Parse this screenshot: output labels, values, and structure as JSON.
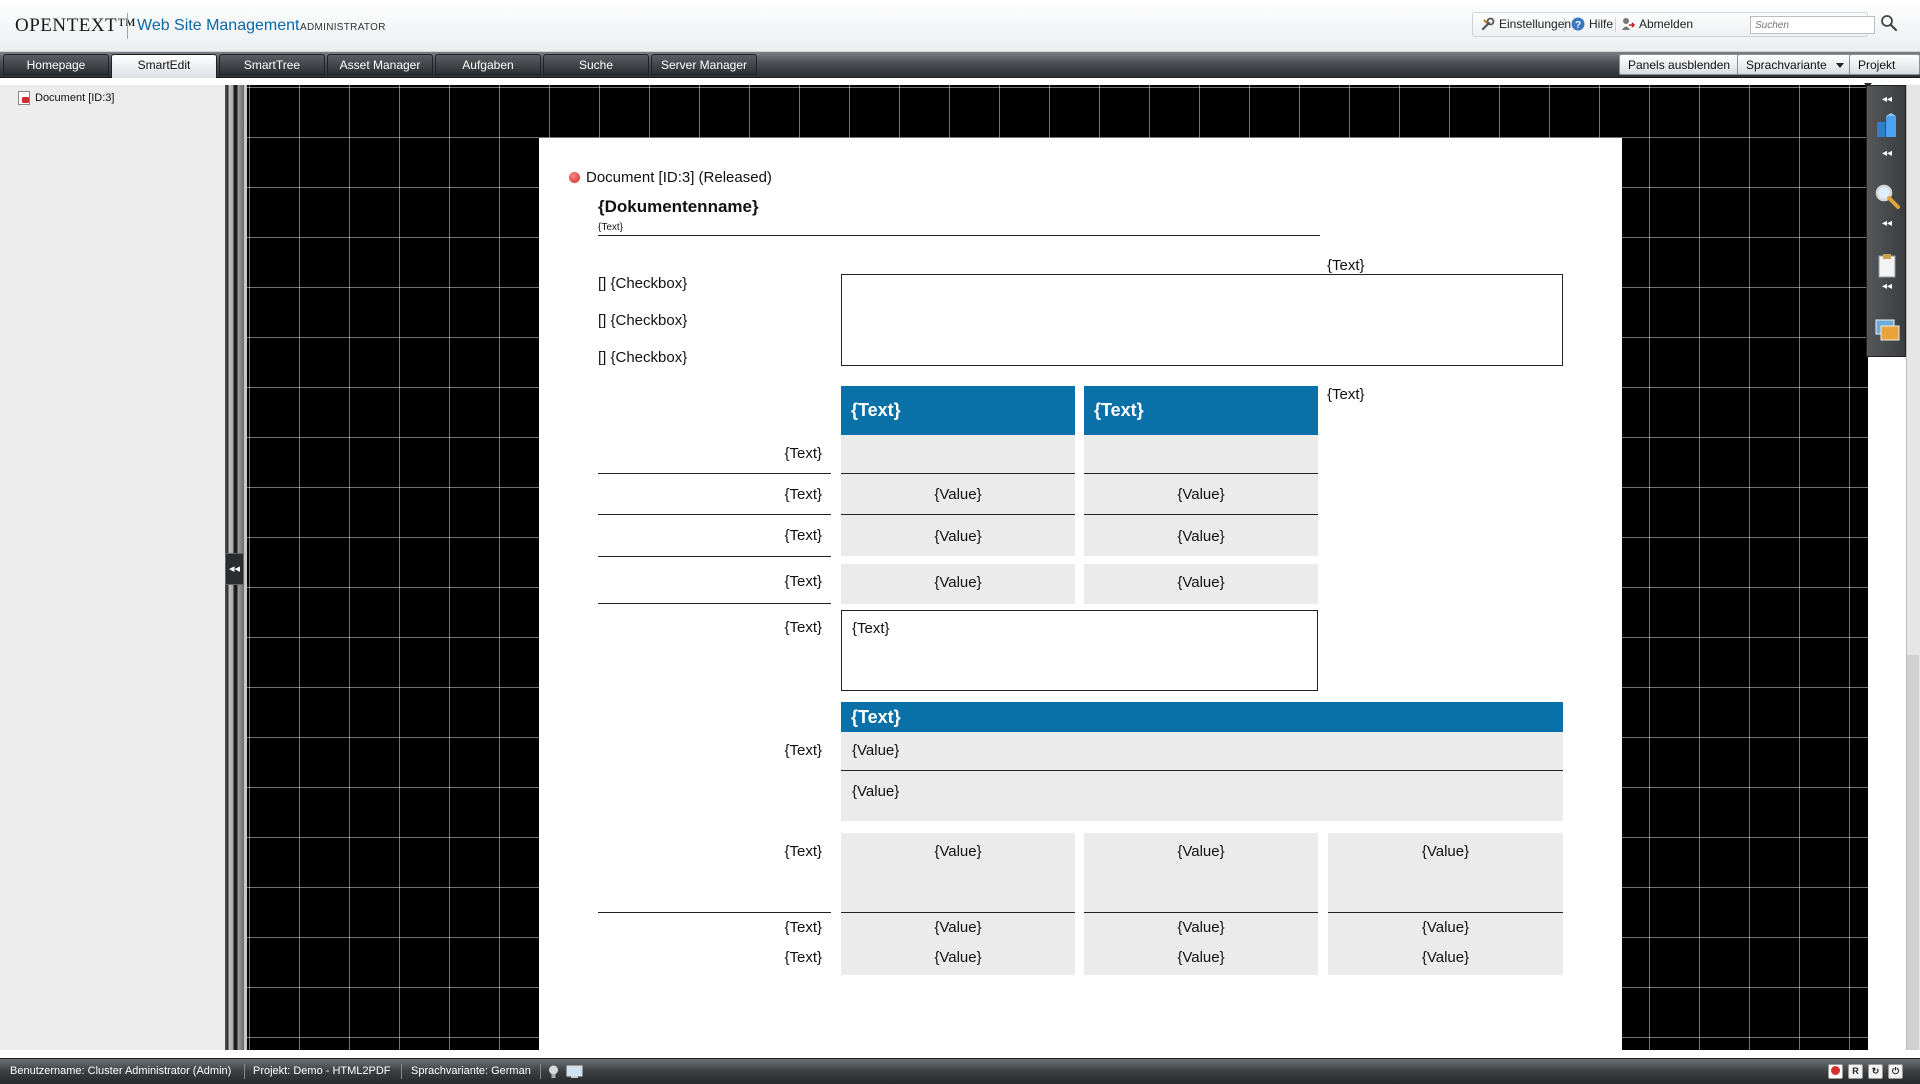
{
  "header": {
    "logo": "OPENTEXT™",
    "app_name": "Web Site Management",
    "role": "ADMINISTRATOR",
    "tools": {
      "settings": "Einstellungen",
      "help": "Hilfe",
      "logout": "Abmelden"
    },
    "search_placeholder": "Suchen"
  },
  "tabs": [
    "Homepage",
    "SmartEdit",
    "SmartTree",
    "Asset Manager",
    "Aufgaben",
    "Suche",
    "Server Manager"
  ],
  "active_tab": "SmartEdit",
  "toolbar_right": {
    "panels": "Panels ausblenden",
    "language": "Sprachvariante",
    "project": "Projekt"
  },
  "tree": {
    "item": "Document [ID:3]"
  },
  "document": {
    "status": "Document [ID:3] (Released)",
    "title": "{Dokumentenname}",
    "subtitle": "{Text}",
    "text_placeholder": "{Text}",
    "value_placeholder": "{Value}",
    "checkbox_label": "[] {Checkbox}",
    "checkboxes": [
      "[] {Checkbox}",
      "[] {Checkbox}",
      "[] {Checkbox}"
    ]
  },
  "statusbar": {
    "user": "Benutzername: Cluster Administrator (Admin)",
    "project": "Projekt: Demo - HTML2PDF",
    "language": "Sprachvariante: German"
  },
  "colors": {
    "accent": "#0a71a8",
    "canvas": "#000000",
    "cell": "#ebebeb"
  },
  "icons": [
    "settings-icon",
    "help-icon",
    "logout-icon",
    "search-icon",
    "document-icon",
    "collapse-icon",
    "building-icon",
    "magnifier-icon",
    "clipboard-icon",
    "images-icon",
    "bulb-icon",
    "monitor-icon",
    "record-icon",
    "r-icon",
    "refresh-icon",
    "power-icon"
  ]
}
